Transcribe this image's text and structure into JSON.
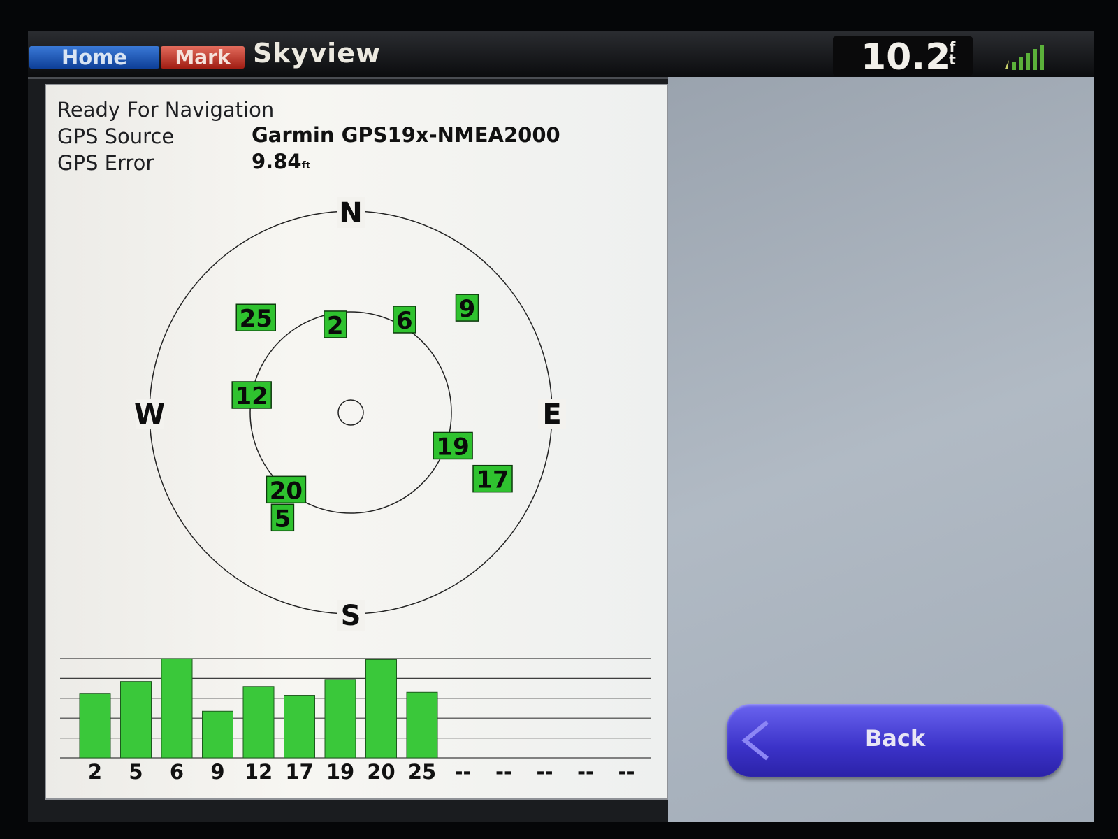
{
  "header": {
    "home_label": "Home",
    "mark_label": "Mark",
    "title": "Skyview",
    "depth_value": "10.2",
    "depth_unit_top": "f",
    "depth_unit_bottom": "t"
  },
  "status": {
    "line1": "Ready For Navigation",
    "source_label": "GPS Source",
    "source_value": "Garmin GPS19x-NMEA2000",
    "error_label": "GPS Error",
    "error_value": "9.84",
    "error_unit": "ft"
  },
  "compass": {
    "north": "N",
    "south": "S",
    "east": "E",
    "west": "W"
  },
  "satellites": [
    {
      "id": "25",
      "azimuth_deg": 315,
      "elevation_deg": 30
    },
    {
      "id": "2",
      "azimuth_deg": 350,
      "elevation_deg": 50
    },
    {
      "id": "6",
      "azimuth_deg": 30,
      "elevation_deg": 42
    },
    {
      "id": "9",
      "azimuth_deg": 48,
      "elevation_deg": 20
    },
    {
      "id": "12",
      "azimuth_deg": 280,
      "elevation_deg": 45
    },
    {
      "id": "19",
      "azimuth_deg": 108,
      "elevation_deg": 42
    },
    {
      "id": "17",
      "azimuth_deg": 115,
      "elevation_deg": 20
    },
    {
      "id": "20",
      "azimuth_deg": 220,
      "elevation_deg": 45
    },
    {
      "id": "5",
      "azimuth_deg": 213,
      "elevation_deg": 34
    }
  ],
  "chart_data": {
    "type": "bar",
    "categories": [
      "2",
      "5",
      "6",
      "9",
      "12",
      "17",
      "19",
      "20",
      "25",
      "--",
      "--",
      "--",
      "--",
      "--"
    ],
    "values": [
      65,
      77,
      100,
      47,
      72,
      63,
      79,
      99,
      66,
      0,
      0,
      0,
      0,
      0
    ],
    "ylim": [
      0,
      100
    ],
    "grid": true
  },
  "back_button": {
    "label": "Back"
  },
  "colors": {
    "satellite_fill": "#2fc22f",
    "bar_fill": "#3ac83a",
    "back_button": "#4a42dc"
  }
}
